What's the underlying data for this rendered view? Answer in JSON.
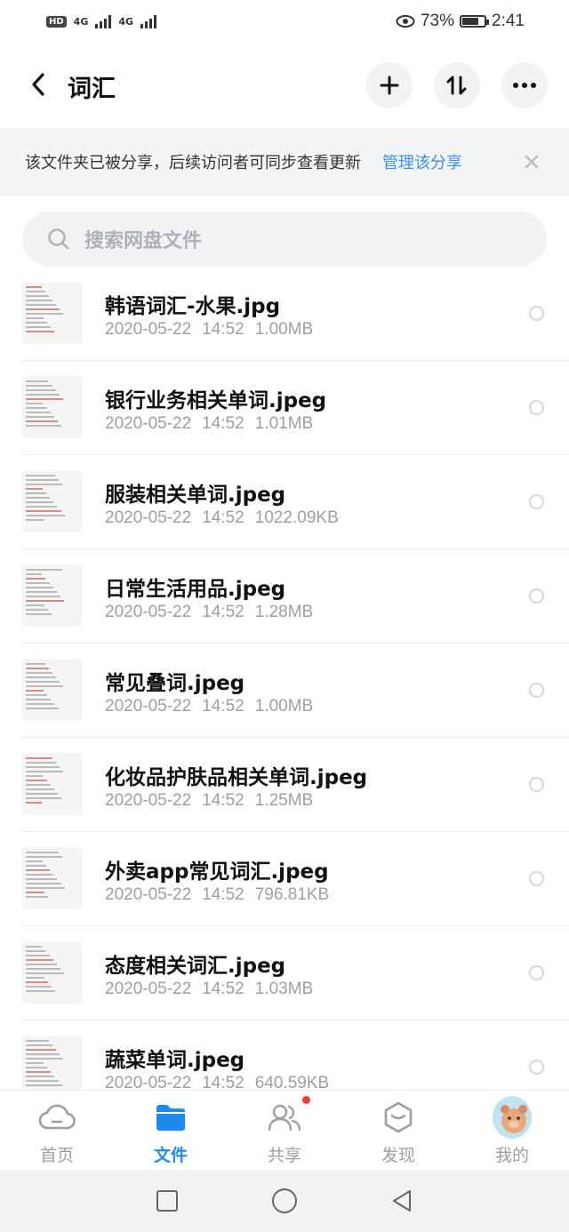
{
  "status_bar": {
    "hd": "HD",
    "net1": "4G",
    "net2": "4G",
    "battery": "73%",
    "time": "2:41",
    "battery_level": 0.73
  },
  "header": {
    "title": "词汇",
    "add_icon": "plus-icon",
    "sort_icon": "sort-icon",
    "more_icon": "more-icon"
  },
  "banner": {
    "text": "该文件夹已被分享，后续访问者可同步查看更新",
    "link": "管理该分享"
  },
  "search": {
    "placeholder": "搜索网盘文件"
  },
  "files": [
    {
      "name": "韩语词汇-水果.jpg",
      "date": "2020-05-22",
      "time": "14:52",
      "size": "1.00MB"
    },
    {
      "name": "银行业务相关单词.jpeg",
      "date": "2020-05-22",
      "time": "14:52",
      "size": "1.01MB"
    },
    {
      "name": "服装相关单词.jpeg",
      "date": "2020-05-22",
      "time": "14:52",
      "size": "1022.09KB"
    },
    {
      "name": "日常生活用品.jpeg",
      "date": "2020-05-22",
      "time": "14:52",
      "size": "1.28MB"
    },
    {
      "name": "常见叠词.jpeg",
      "date": "2020-05-22",
      "time": "14:52",
      "size": "1.00MB"
    },
    {
      "name": "化妆品护肤品相关单词.jpeg",
      "date": "2020-05-22",
      "time": "14:52",
      "size": "1.25MB"
    },
    {
      "name": "外卖app常见词汇.jpeg",
      "date": "2020-05-22",
      "time": "14:52",
      "size": "796.81KB"
    },
    {
      "name": "态度相关词汇.jpeg",
      "date": "2020-05-22",
      "time": "14:52",
      "size": "1.03MB"
    },
    {
      "name": "蔬菜单词.jpeg",
      "date": "2020-05-22",
      "time": "14:52",
      "size": "640.59KB"
    }
  ],
  "nav": [
    {
      "label": "首页",
      "icon": "cloud-icon"
    },
    {
      "label": "文件",
      "icon": "folder-icon"
    },
    {
      "label": "共享",
      "icon": "people-icon"
    },
    {
      "label": "发现",
      "icon": "discover-icon"
    },
    {
      "label": "我的",
      "icon": "avatar"
    }
  ],
  "colors": {
    "accent": "#1a8bf0",
    "link": "#3a8ff0",
    "badge": "#ee3b3b"
  }
}
